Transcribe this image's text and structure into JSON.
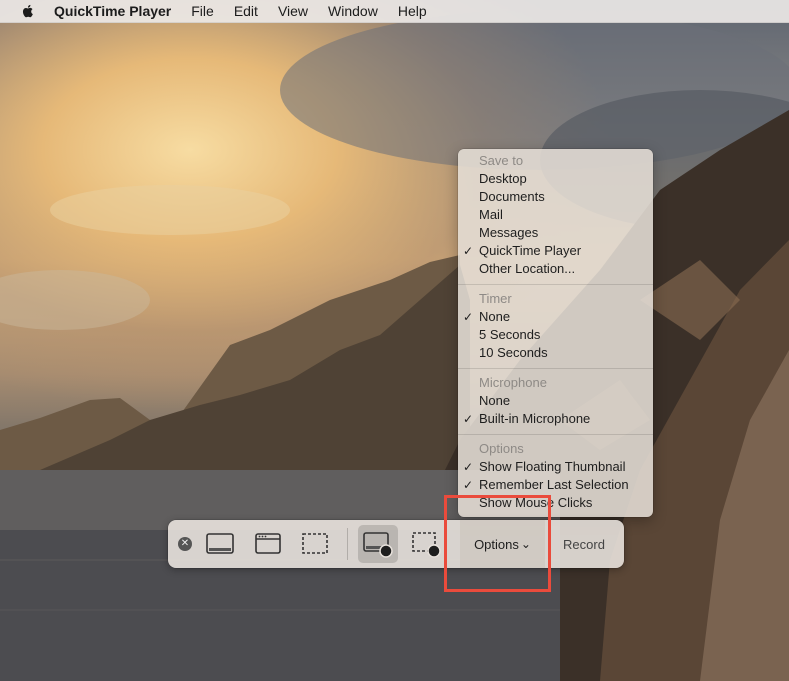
{
  "menubar": {
    "apple_icon": "apple-logo-icon",
    "app_name": "QuickTime Player",
    "items": [
      "File",
      "Edit",
      "View",
      "Window",
      "Help"
    ]
  },
  "options_menu": {
    "sections": [
      {
        "header": "Save to",
        "items": [
          {
            "label": "Desktop",
            "checked": false
          },
          {
            "label": "Documents",
            "checked": false
          },
          {
            "label": "Mail",
            "checked": false
          },
          {
            "label": "Messages",
            "checked": false
          },
          {
            "label": "QuickTime Player",
            "checked": true
          },
          {
            "label": "Other Location...",
            "checked": false
          }
        ]
      },
      {
        "header": "Timer",
        "items": [
          {
            "label": "None",
            "checked": true
          },
          {
            "label": "5 Seconds",
            "checked": false
          },
          {
            "label": "10 Seconds",
            "checked": false
          }
        ]
      },
      {
        "header": "Microphone",
        "items": [
          {
            "label": "None",
            "checked": false
          },
          {
            "label": "Built-in Microphone",
            "checked": true
          }
        ]
      },
      {
        "header": "Options",
        "items": [
          {
            "label": "Show Floating Thumbnail",
            "checked": true
          },
          {
            "label": "Remember Last Selection",
            "checked": true
          },
          {
            "label": "Show Mouse Clicks",
            "checked": false
          }
        ]
      }
    ],
    "check_mark": "✓"
  },
  "toolbar": {
    "close_glyph": "✕",
    "options_label": "Options",
    "options_chevron": "⌄",
    "record_label": "Record",
    "icons": [
      "capture-entire-screen-icon",
      "capture-selected-window-icon",
      "capture-selected-portion-icon",
      "record-entire-screen-icon",
      "record-selected-portion-icon"
    ]
  },
  "colors": {
    "highlight": "#ea4b3c"
  }
}
